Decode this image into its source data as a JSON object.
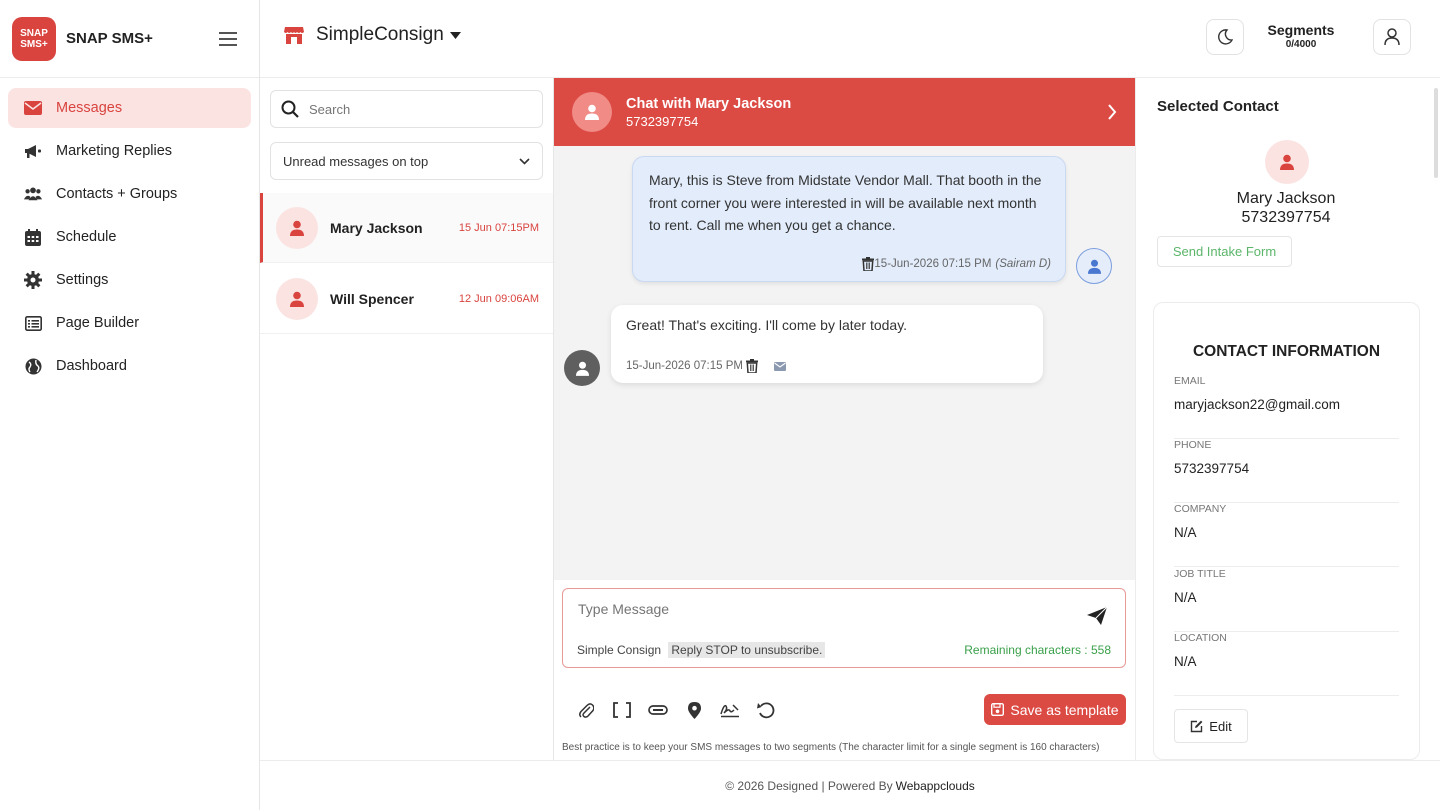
{
  "brand": {
    "logo_line1": "SNAP",
    "logo_line2": "SMS+",
    "name": "SNAP SMS+"
  },
  "sidebar": {
    "items": [
      {
        "label": "Messages",
        "icon": "envelope-icon",
        "active": true
      },
      {
        "label": "Marketing Replies",
        "icon": "megaphone-icon"
      },
      {
        "label": "Contacts + Groups",
        "icon": "users-icon"
      },
      {
        "label": "Schedule",
        "icon": "calendar-icon"
      },
      {
        "label": "Settings",
        "icon": "gear-icon"
      },
      {
        "label": "Page Builder",
        "icon": "list-icon"
      },
      {
        "label": "Dashboard",
        "icon": "globe-icon"
      }
    ]
  },
  "header": {
    "store_name": "SimpleConsign",
    "segments_title": "Segments",
    "segments_value": "0/4000"
  },
  "conversations": {
    "search_placeholder": "Search",
    "sort_label": "Unread messages on top",
    "items": [
      {
        "name": "Mary Jackson",
        "time": "15 Jun 07:15PM",
        "active": true
      },
      {
        "name": "Will Spencer",
        "time": "12 Jun 09:06AM"
      }
    ]
  },
  "chat": {
    "header_title": "Chat with Mary Jackson",
    "header_phone": "5732397754",
    "messages": [
      {
        "direction": "outgoing",
        "text": "Mary, this is Steve from Midstate Vendor Mall. That booth in the front corner you were interested in will be available next month to rent. Call me when you get a chance.",
        "timestamp": "15-Jun-2026 07:15 PM",
        "sender": "(Sairam D)"
      },
      {
        "direction": "incoming",
        "text": "Great! That's exciting. I'll come by later today.",
        "timestamp": "15-Jun-2026 07:15 PM"
      }
    ],
    "composer": {
      "placeholder": "Type Message",
      "signature": "Simple Consign",
      "stop_text": "Reply STOP to unsubscribe.",
      "remaining": "Remaining characters : 558"
    },
    "save_template_label": "Save as template",
    "hint": "Best practice is to keep your SMS messages to two segments (The character limit for a single segment is 160 characters)"
  },
  "contact": {
    "panel_title": "Selected Contact",
    "name": "Mary Jackson",
    "phone": "5732397754",
    "intake_label": "Send Intake Form",
    "info_title": "CONTACT INFORMATION",
    "fields": [
      {
        "label": "EMAIL",
        "value": "maryjackson22@gmail.com"
      },
      {
        "label": "PHONE",
        "value": "5732397754"
      },
      {
        "label": "COMPANY",
        "value": "N/A"
      },
      {
        "label": "JOB TITLE",
        "value": "N/A"
      },
      {
        "label": "LOCATION",
        "value": "N/A"
      }
    ],
    "edit_label": "Edit"
  },
  "footer": {
    "text": "© 2026 Designed | Powered By",
    "link": "Webappclouds"
  },
  "colors": {
    "accent": "#dc4a44",
    "accent_light": "#fbe3e2",
    "success": "#3aa04a",
    "bubble_out": "#e2ecfb"
  }
}
